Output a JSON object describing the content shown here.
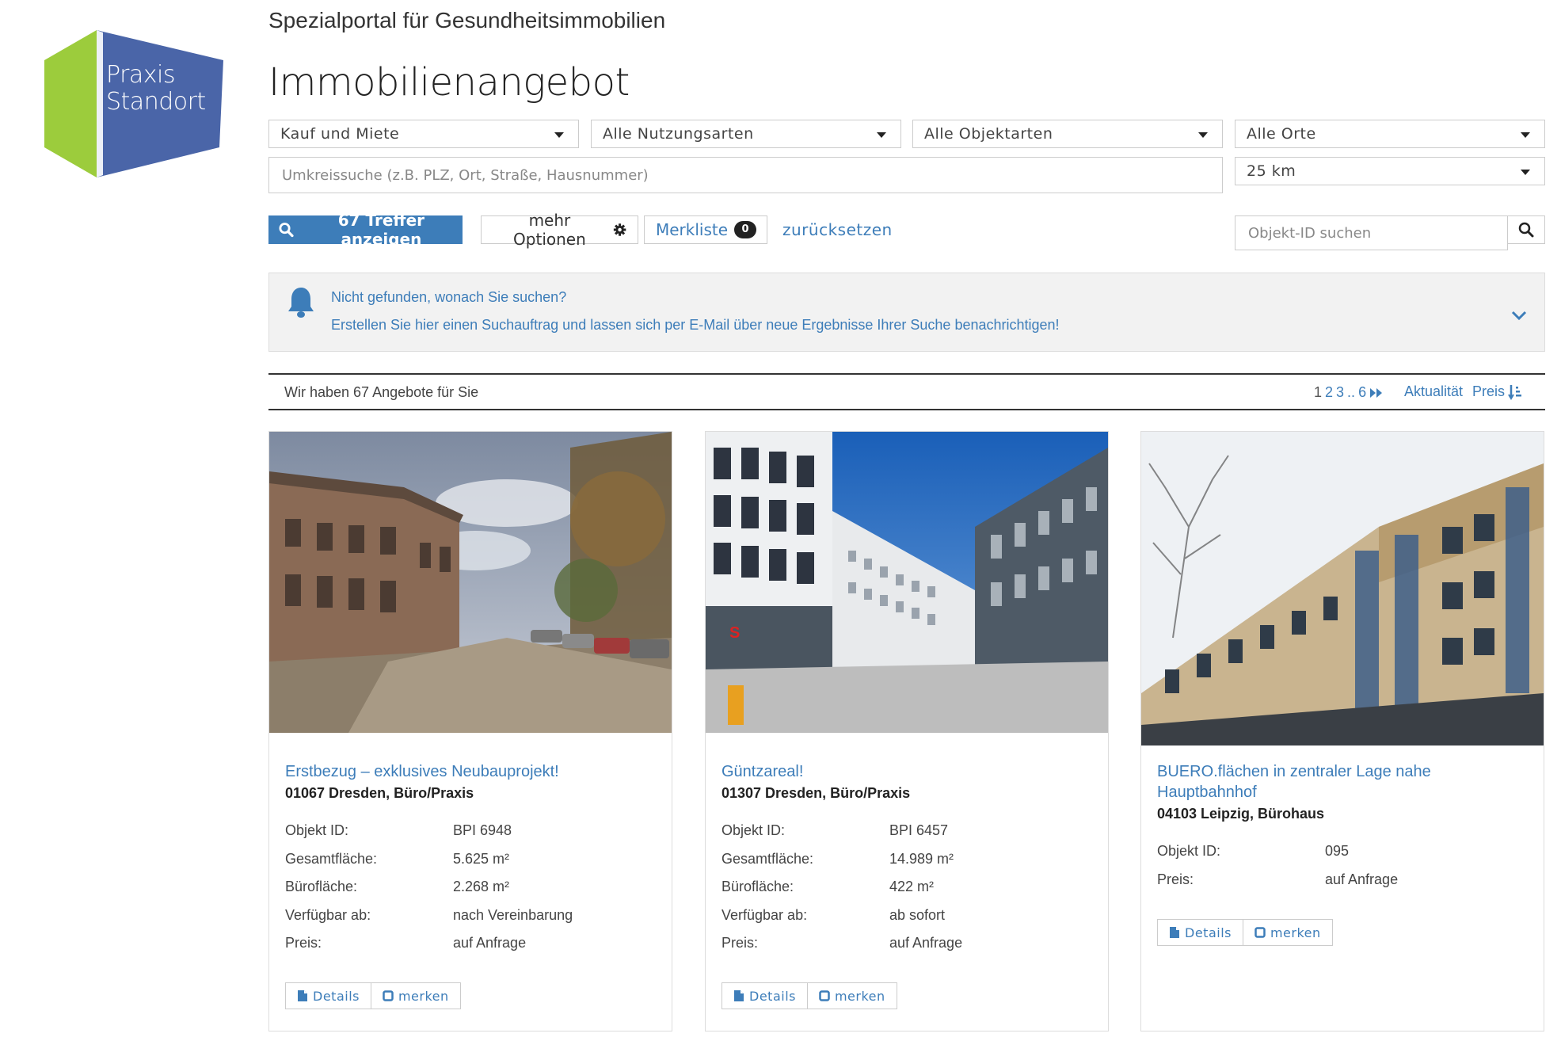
{
  "brand": {
    "logo_line1": "Praxis",
    "logo_line2": "Standort",
    "tagline": "Spezialportal für Gesundheitsimmobilien",
    "colors": {
      "green": "#9ccc3c",
      "blue": "#4a65a8",
      "accent": "#3d7db9"
    }
  },
  "page_title": "Immobilienangebot",
  "filters": {
    "marketing_type": "Kauf und Miete",
    "usage_type": "Alle Nutzungsarten",
    "object_type": "Alle Objektarten",
    "location": "Alle Orte",
    "radius_placeholder": "Umkreissuche (z.B. PLZ, Ort, Straße, Hausnummer)",
    "radius": "25 km"
  },
  "actions": {
    "search_button": "67 Treffer anzeigen",
    "more_options": "mehr Optionen",
    "watchlist": "Merkliste",
    "watchlist_count": "0",
    "reset": "zurücksetzen",
    "id_search_placeholder": "Objekt-ID suchen"
  },
  "notice": {
    "line1": "Nicht gefunden, wonach Sie suchen?",
    "line2": "Erstellen Sie hier einen Suchauftrag und lassen sich per E-Mail über neue Ergebnisse Ihrer Suche benachrichtigen!"
  },
  "results": {
    "count_text": "Wir haben 67 Angebote für Sie",
    "pages": [
      "1",
      "2",
      "3",
      "..",
      "6"
    ],
    "current_page": "1",
    "sort_recency": "Aktualität",
    "sort_price": "Preis"
  },
  "listings": [
    {
      "title": "Erstbezug – exklusives Neubauprojekt!",
      "subtitle": "01067 Dresden, Büro/Praxis",
      "facts": [
        {
          "label": "Objekt ID:",
          "value": "BPI 6948"
        },
        {
          "label": "Gesamtfläche:",
          "value": "5.625 m²"
        },
        {
          "label": "Bürofläche:",
          "value": "2.268 m²"
        },
        {
          "label": "Verfügbar ab:",
          "value": "nach Vereinbarung"
        },
        {
          "label": "Preis:",
          "value": "auf Anfrage"
        }
      ],
      "details_label": "Details",
      "save_label": "merken"
    },
    {
      "title": "Güntzareal!",
      "subtitle": "01307 Dresden, Büro/Praxis",
      "facts": [
        {
          "label": "Objekt ID:",
          "value": "BPI 6457"
        },
        {
          "label": "Gesamtfläche:",
          "value": "14.989 m²"
        },
        {
          "label": "Bürofläche:",
          "value": "422 m²"
        },
        {
          "label": "Verfügbar ab:",
          "value": "ab sofort"
        },
        {
          "label": "Preis:",
          "value": "auf Anfrage"
        }
      ],
      "details_label": "Details",
      "save_label": "merken"
    },
    {
      "title": "BUERO.flächen in zentraler Lage nahe Hauptbahnhof",
      "subtitle": "04103 Leipzig, Bürohaus",
      "facts": [
        {
          "label": "Objekt ID:",
          "value": "095"
        },
        {
          "label": "Preis:",
          "value": "auf Anfrage"
        }
      ],
      "details_label": "Details",
      "save_label": "merken"
    }
  ]
}
